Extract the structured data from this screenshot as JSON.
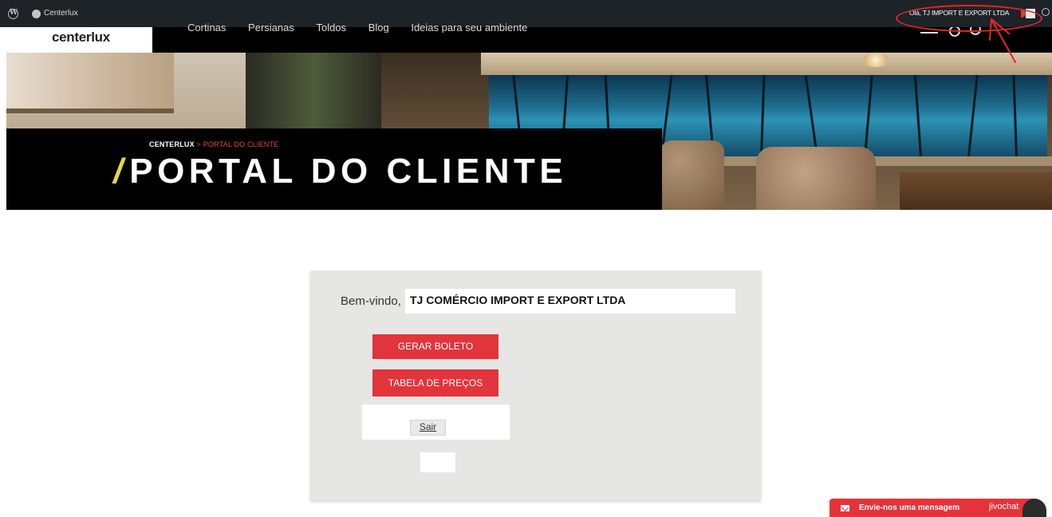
{
  "adminbar": {
    "site_name": "Centerlux",
    "howdy": "Olá, TJ IMPORT E EXPORT LTDA"
  },
  "header": {
    "logo": "centerlux",
    "nav": [
      "Cortinas",
      "Persianas",
      "Toldos",
      "Blog",
      "Ideias para seu ambiente"
    ]
  },
  "hero": {
    "breadcrumb": {
      "home": "CENTERLUX",
      "separator": ">",
      "current": "PORTAL DO CLIENTE"
    },
    "slash": "/",
    "title": "PORTAL DO CLIENTE"
  },
  "portal": {
    "welcome_label": "Bem-vindo,",
    "client_name": "TJ COMÉRCIO IMPORT E EXPORT LTDA",
    "buttons": {
      "boleto": "GERAR BOLETO",
      "precos": "TABELA DE PREÇOS",
      "logout": "Sair"
    }
  },
  "chat": {
    "label": "Envie-nos uma mensagem",
    "brand": "jivochat"
  },
  "colors": {
    "accent_red": "#e2343b",
    "title_slash": "#e2d84a",
    "admin_bar": "#1d2327",
    "card_bg": "#e6e6e4"
  }
}
